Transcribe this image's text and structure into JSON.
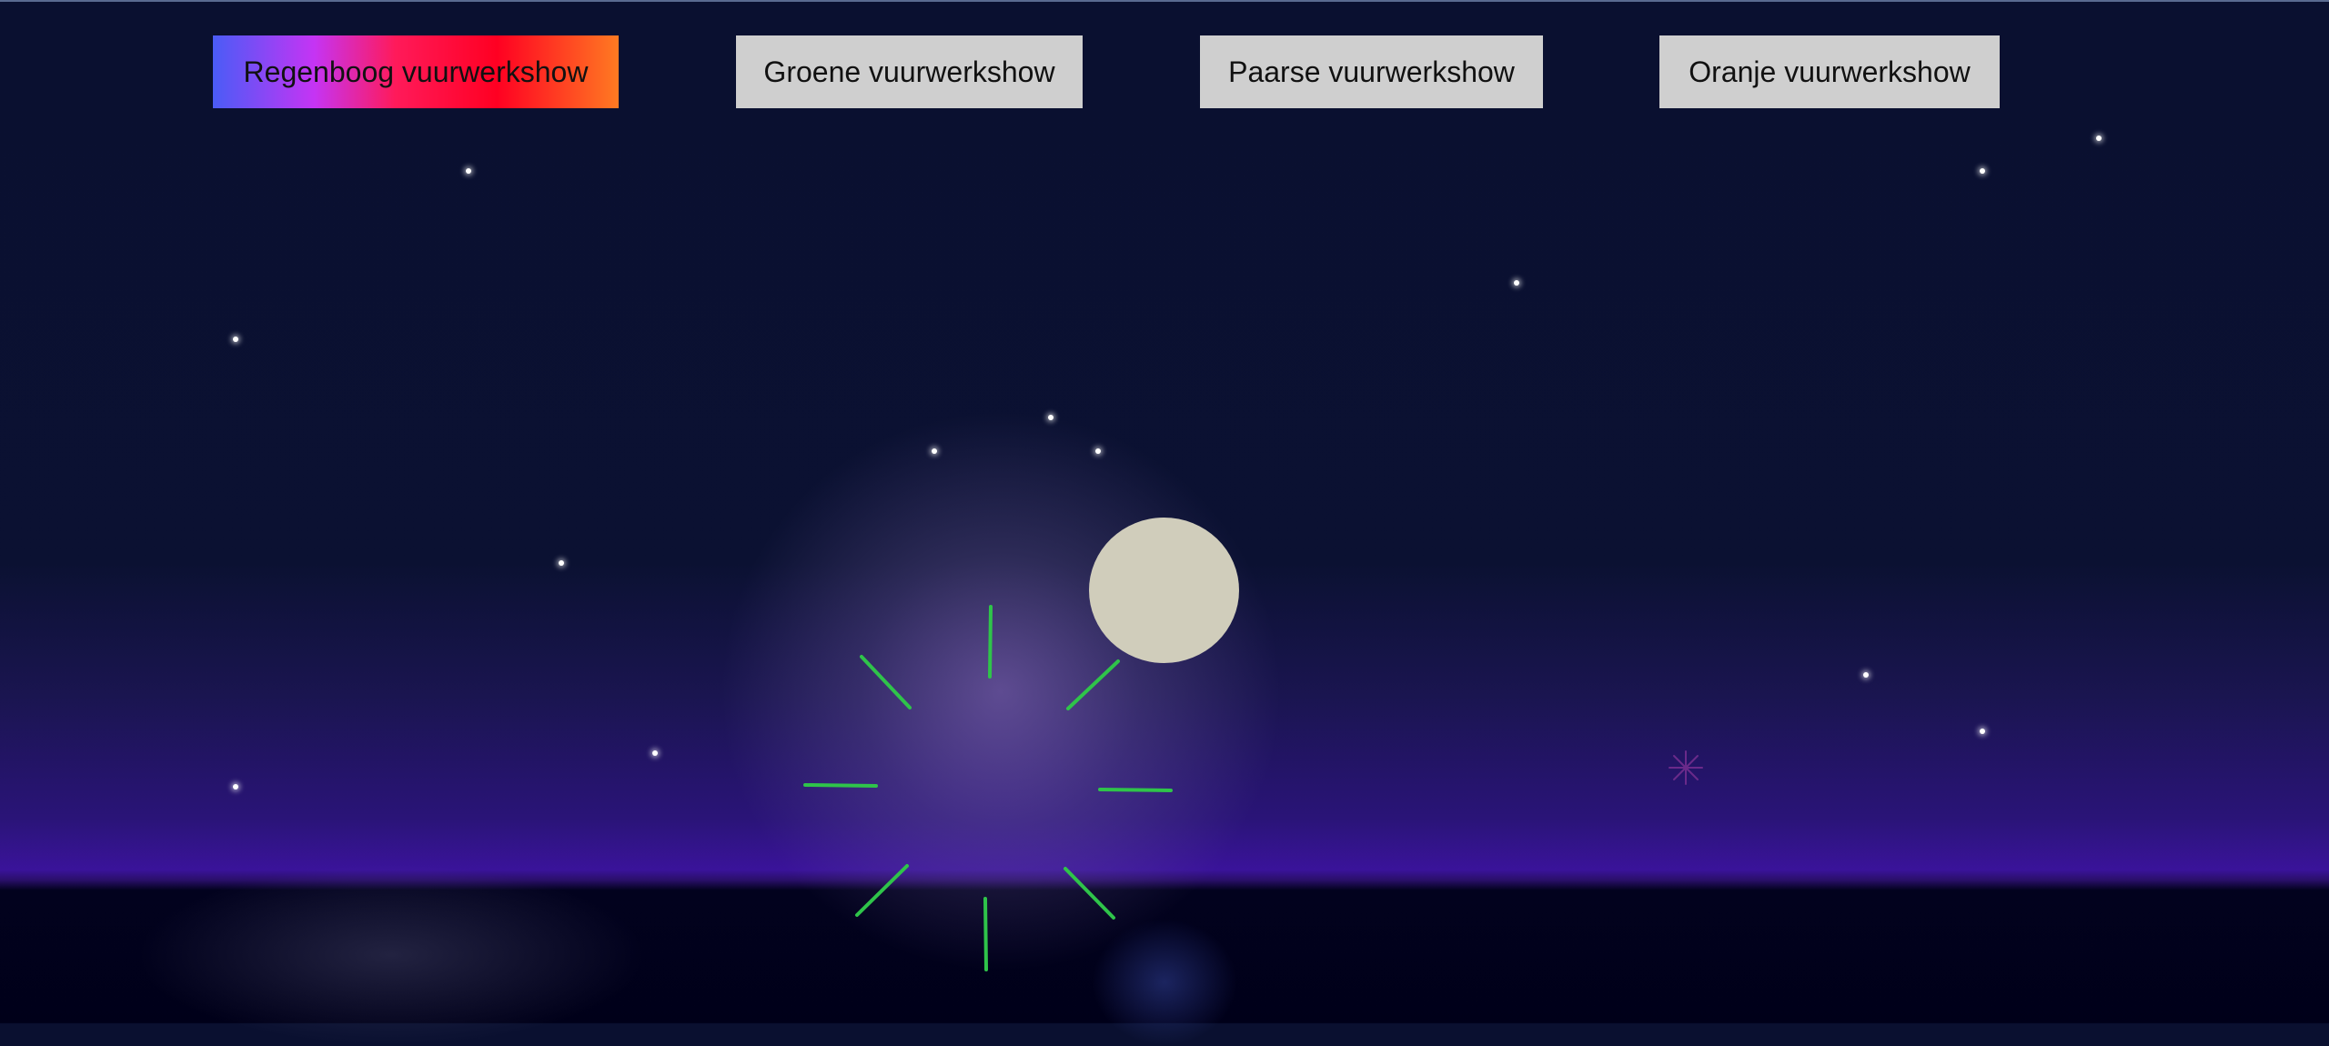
{
  "buttons": {
    "rainbow": "Regenboog vuurwerkshow",
    "green": "Groene vuurwerkshow",
    "purple": "Paarse vuurwerkshow",
    "orange": "Oranje vuurwerkshow"
  },
  "colors": {
    "firework_green": "#2fc44a",
    "firework_purple": "#6a2a8a",
    "moon": "#d0cdbb",
    "button_gray": "#cfcfcf"
  },
  "icons": {
    "firework_burst": "green-firework-burst-icon",
    "small_burst": "purple-firework-spark-icon"
  }
}
